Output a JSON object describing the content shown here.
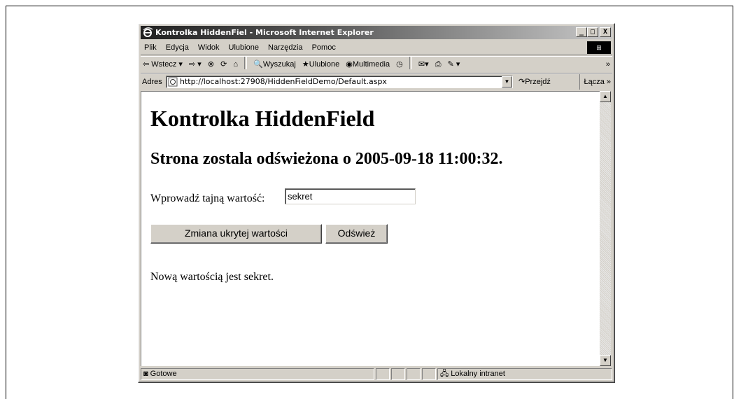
{
  "window": {
    "title": "Kontrolka HiddenFiel - Microsoft Internet Explorer",
    "min": "_",
    "max": "□",
    "close": "X"
  },
  "menu": [
    "Plik",
    "Edycja",
    "Widok",
    "Ulubione",
    "Narzędzia",
    "Pomoc"
  ],
  "toolbar": {
    "back": "⇦ Wstecz ▾",
    "forward": "⇨ ▾",
    "stop": "⊗",
    "refresh": "⟳",
    "home": "⌂",
    "search": "Wyszukaj",
    "favorites": "Ulubione",
    "media": "Multimedia",
    "history": "◷",
    "mail": "✉▾",
    "print": "⎙",
    "edit": "✎ ▾",
    "more": "»"
  },
  "address": {
    "label": "Adres",
    "url": "http://localhost:27908/HiddenFieldDemo/Default.aspx",
    "go": "Przejdź",
    "links": "Łącza »"
  },
  "page": {
    "heading": "Kontrolka HiddenField",
    "subheading": "Strona zostala odświeżona o 2005-09-18 11:00:32.",
    "input_label": "Wprowadź tajną wartość:",
    "input_value": "sekret",
    "change_button": "Zmiana ukrytej wartości",
    "refresh_button": "Odśwież",
    "message": "Nową wartością jest sekret."
  },
  "status": {
    "text": "Gotowe",
    "zone": "Lokalny intranet"
  }
}
